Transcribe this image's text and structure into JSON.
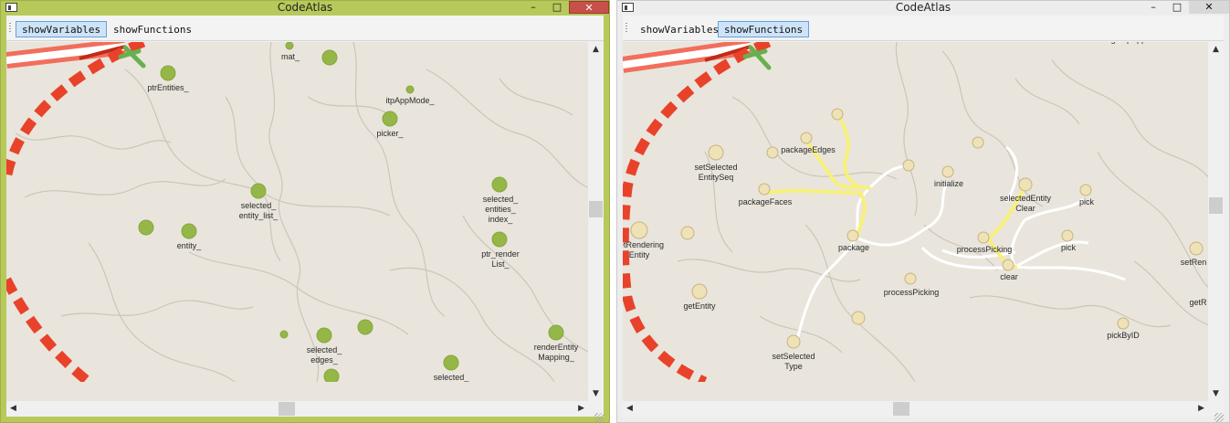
{
  "left_window": {
    "title": "CodeAtlas",
    "controls": {
      "minimize": "–",
      "maximize": "□",
      "close": "✕"
    },
    "toolbar": {
      "buttons": [
        {
          "label": "showVariables",
          "checked": true
        },
        {
          "label": "showFunctions",
          "checked": false
        }
      ]
    },
    "map": {
      "labels": [
        "mat_",
        "ptrEntities_",
        "itpAppMode_",
        "picker_",
        "selected_",
        "entity_list_",
        "selected_",
        "entities_",
        "index_",
        "ptr_render",
        "List_",
        "entity_",
        "selected_",
        "edges_",
        "renderEntity",
        "Mapping_",
        "selected_"
      ]
    },
    "scrollbar_arrows": {
      "up": "▲",
      "down": "▼",
      "left": "◀",
      "right": "▶"
    }
  },
  "right_window": {
    "title": "CodeAtlas",
    "controls": {
      "minimize": "–",
      "maximize": "□",
      "close": "✕"
    },
    "toolbar": {
      "buttons": [
        {
          "label": "showVariables",
          "checked": false
        },
        {
          "label": "showFunctions",
          "checked": true
        }
      ]
    },
    "map": {
      "labels": [
        "getItpAppMode",
        "packageEdges",
        "setSelected",
        "EntitySeq",
        "packageFaces",
        "initialize",
        "selectedEntity",
        "Clear",
        "pick",
        "getRendering",
        "Entity",
        "package",
        "processPicking",
        "pick",
        "clear",
        "setRen",
        "getEntity",
        "processPicking",
        "getR",
        "setSelected",
        "Type",
        "pickByID"
      ]
    },
    "scrollbar_arrows": {
      "up": "▲",
      "down": "▼",
      "left": "◀",
      "right": "▶"
    }
  },
  "colors": {
    "map_background": "#e9e5dc",
    "variable_node": "#94b748",
    "function_node": "#efe2b6",
    "highlight_path": "#f7f07a",
    "call_edge": "#ffffff",
    "territory_border": "#e8432a",
    "toolbar_checked": "#cde3f7",
    "left_window_frame": "#b7c95a"
  }
}
